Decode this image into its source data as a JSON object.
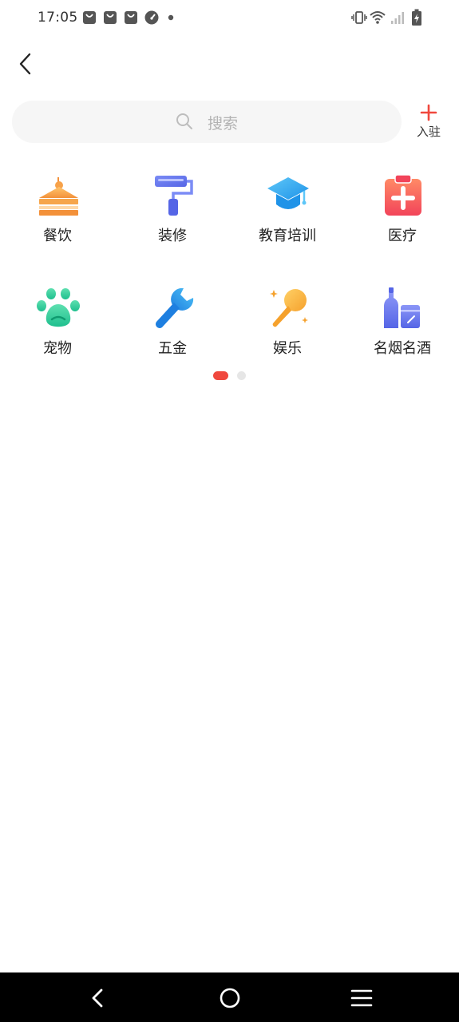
{
  "status_bar": {
    "time": "17:05",
    "icons": [
      "bag-icon",
      "bag-icon",
      "bag-icon",
      "gauge-icon",
      "dot-icon",
      "vibrate-icon",
      "wifi-icon",
      "signal-icon",
      "battery-charging-icon"
    ]
  },
  "header": {
    "back_icon": "chevron-left-icon"
  },
  "search": {
    "placeholder": "搜索",
    "icon": "search-icon"
  },
  "join": {
    "label": "入驻",
    "icon": "plus-icon",
    "accent": "#f0483e"
  },
  "categories": [
    {
      "label": "餐饮",
      "icon": "cake-icon"
    },
    {
      "label": "装修",
      "icon": "paint-roller-icon"
    },
    {
      "label": "教育培训",
      "icon": "graduation-cap-icon"
    },
    {
      "label": "医疗",
      "icon": "medical-clipboard-icon"
    },
    {
      "label": "宠物",
      "icon": "paw-icon"
    },
    {
      "label": "五金",
      "icon": "wrench-icon"
    },
    {
      "label": "娱乐",
      "icon": "microphone-icon"
    },
    {
      "label": "名烟名酒",
      "icon": "bottle-icon"
    }
  ],
  "pager": {
    "pages": 2,
    "active": 1,
    "active_color": "#f0483e",
    "inactive_color": "#e6e6e6"
  },
  "nav_bar": {
    "icons": [
      "back-icon",
      "home-icon",
      "menu-icon"
    ]
  },
  "colors": {
    "text": "#222222",
    "placeholder": "#b3b3b3",
    "search_bg": "#f6f6f6"
  }
}
